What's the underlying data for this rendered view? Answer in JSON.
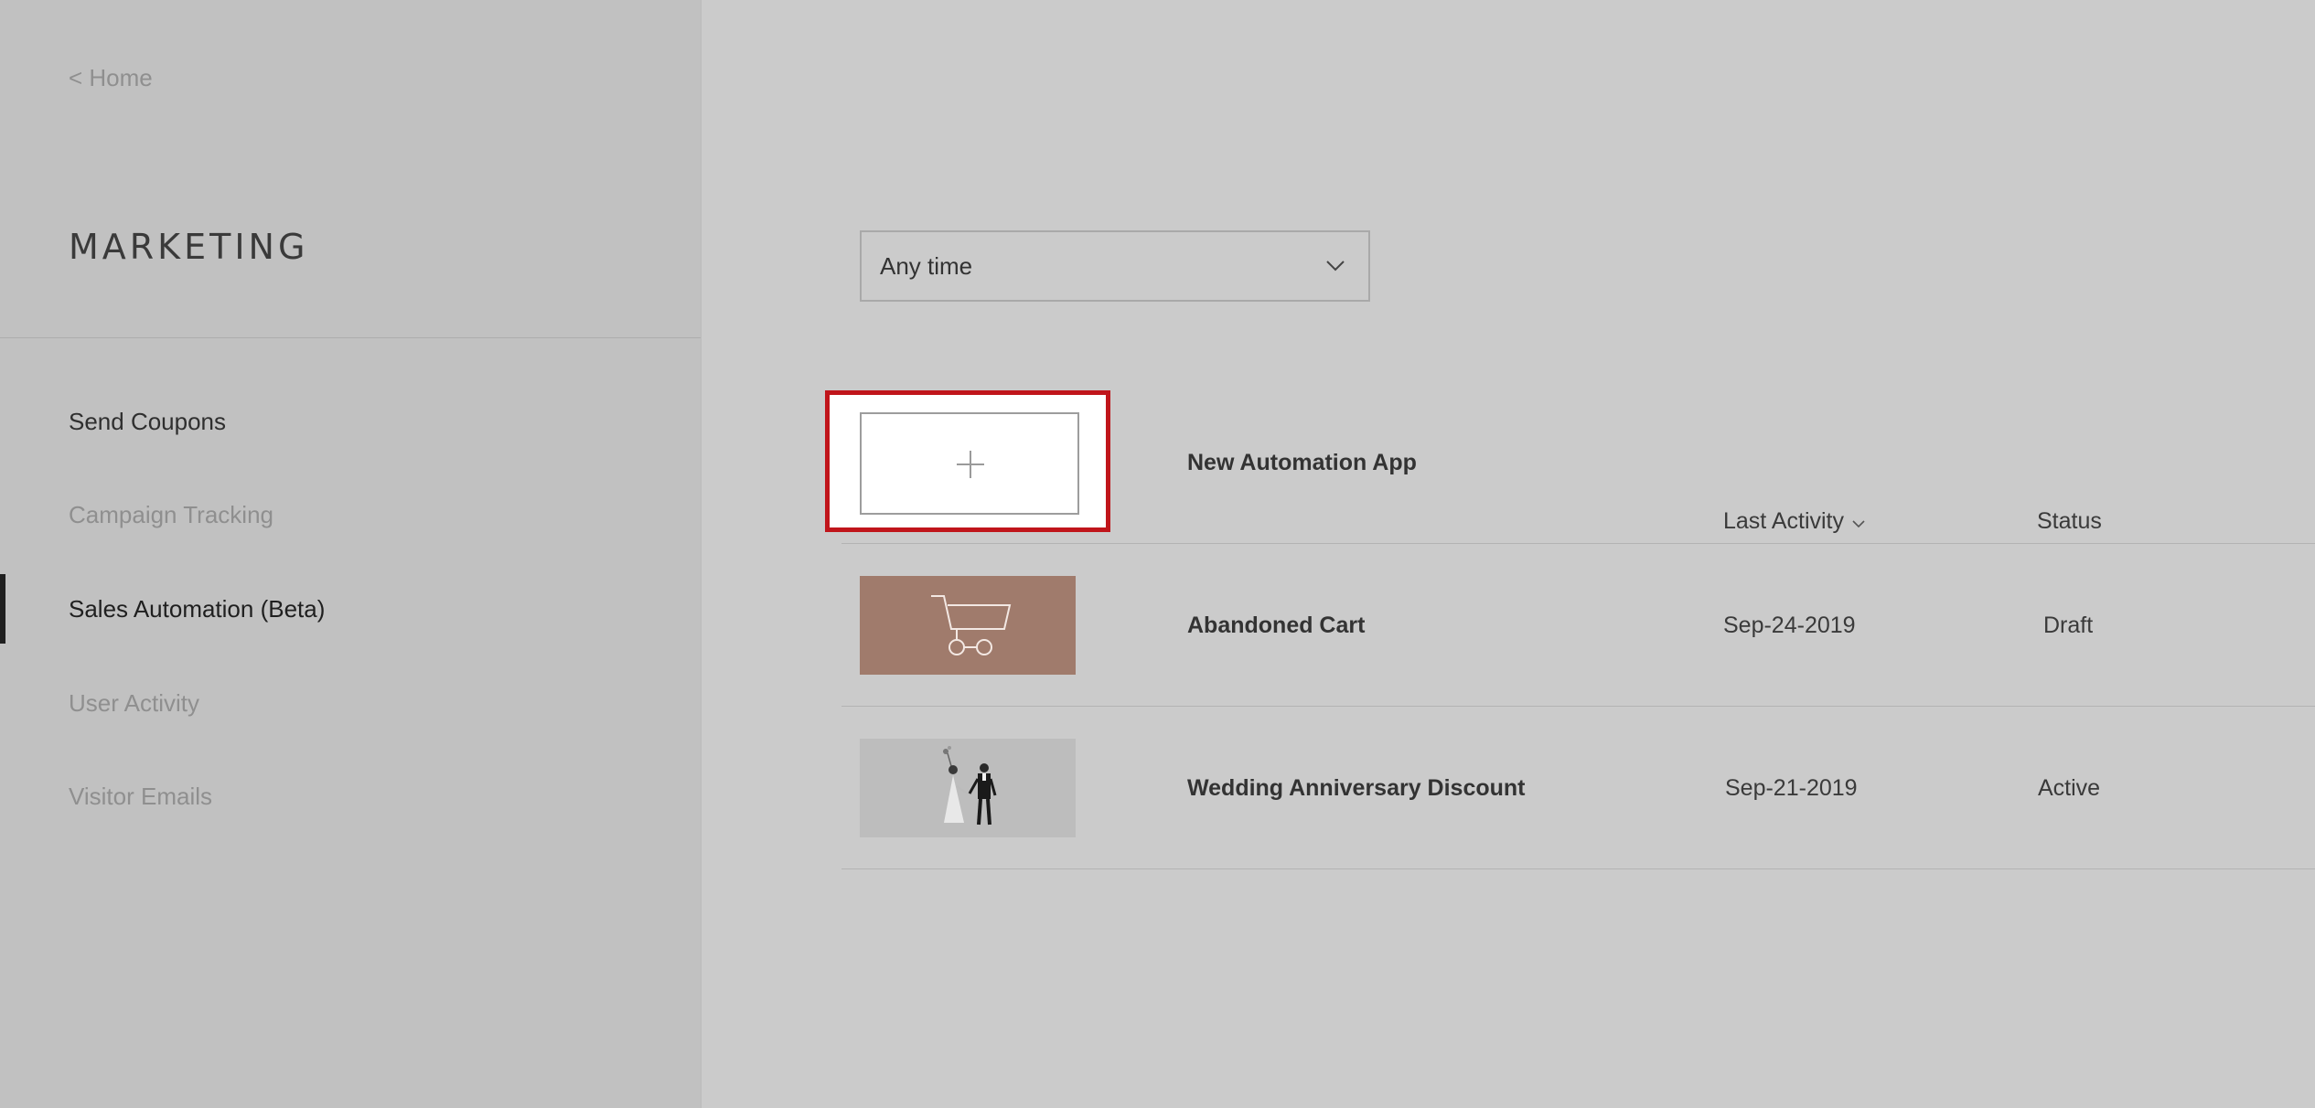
{
  "sidebar": {
    "back_label": "< Home",
    "title": "MARKETING",
    "items": [
      {
        "label": "Send Coupons",
        "state": "normal"
      },
      {
        "label": "Campaign Tracking",
        "state": "muted"
      },
      {
        "label": "Sales Automation (Beta)",
        "state": "active"
      },
      {
        "label": "User Activity",
        "state": "muted"
      },
      {
        "label": "Visitor Emails",
        "state": "muted"
      }
    ]
  },
  "filter": {
    "selected": "Any time",
    "icon": "chevron-down-icon"
  },
  "new_app": {
    "label": "New Automation App",
    "icon": "plus-icon"
  },
  "columns": {
    "last_activity": "Last Activity",
    "status": "Status",
    "sort_icon": "chevron-down-icon"
  },
  "rows": [
    {
      "name": "Abandoned Cart",
      "date": "Sep-24-2019",
      "status": "Draft",
      "thumb_icon": "shopping-cart-icon",
      "thumb_color": "#a07b6c"
    },
    {
      "name": "Wedding Anniversary Discount",
      "date": "Sep-21-2019",
      "status": "Active",
      "thumb_icon": "wedding-couple-illustration",
      "thumb_color": "#bdbdbd"
    }
  ],
  "colors": {
    "highlight": "#c0151b",
    "sidebar_bg": "#c1c1c1",
    "main_bg": "#cbcbcb"
  }
}
